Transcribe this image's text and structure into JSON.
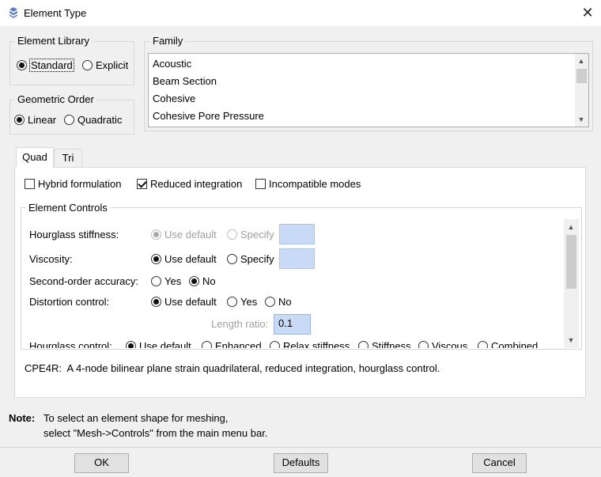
{
  "window": {
    "title": "Element Type",
    "close_icon": "close-icon"
  },
  "element_library": {
    "label": "Element Library",
    "options": [
      {
        "label": "Standard",
        "selected": true
      },
      {
        "label": "Explicit",
        "selected": false
      }
    ]
  },
  "geometric_order": {
    "label": "Geometric Order",
    "options": [
      {
        "label": "Linear",
        "selected": true
      },
      {
        "label": "Quadratic",
        "selected": false
      }
    ]
  },
  "family": {
    "label": "Family",
    "items": [
      "Acoustic",
      "Beam Section",
      "Cohesive",
      "Cohesive Pore Pressure"
    ]
  },
  "tabs": [
    {
      "label": "Quad",
      "active": true
    },
    {
      "label": "Tri",
      "active": false
    }
  ],
  "formulation": [
    {
      "label": "Hybrid formulation",
      "checked": false
    },
    {
      "label": "Reduced integration",
      "checked": true
    },
    {
      "label": "Incompatible modes",
      "checked": false
    }
  ],
  "element_controls": {
    "label": "Element Controls",
    "rows": [
      {
        "label": "Hourglass stiffness:",
        "options": [
          "Use default",
          "Specify"
        ],
        "selected": 0,
        "disabled": true
      },
      {
        "label": "Viscosity:",
        "options": [
          "Use default",
          "Specify"
        ],
        "selected": 0,
        "disabled": false
      },
      {
        "label": "Second-order accuracy:",
        "options": [
          "Yes",
          "No"
        ],
        "selected": 1
      },
      {
        "label": "Distortion control:",
        "options": [
          "Use default",
          "Yes",
          "No"
        ],
        "selected": 0
      }
    ],
    "length_ratio": {
      "label": "Length ratio:",
      "value": "0.1"
    },
    "hourglass_control": {
      "label": "Hourglass control:",
      "options": [
        "Use default",
        "Enhanced",
        "Relax stiffness",
        "Stiffness",
        "Viscous",
        "Combined"
      ],
      "selected": 0
    }
  },
  "description": "CPE4R:  A 4-node bilinear plane strain quadrilateral, reduced integration, hourglass control.",
  "note": {
    "label": "Note:",
    "line1": "To select an element shape for meshing,",
    "line2": "select \"Mesh->Controls\" from the main menu bar."
  },
  "buttons": {
    "ok": "OK",
    "defaults": "Defaults",
    "cancel": "Cancel"
  }
}
